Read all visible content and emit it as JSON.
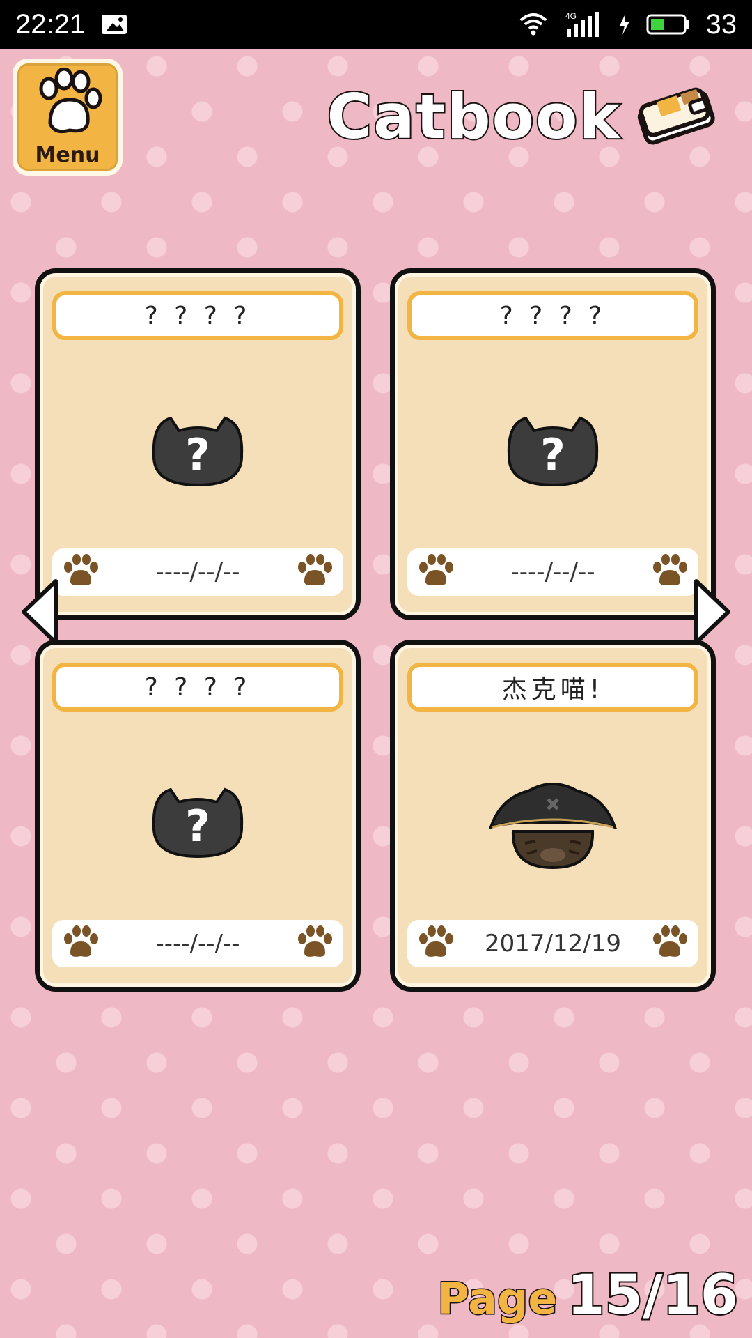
{
  "status_bar": {
    "time": "22:21",
    "network": "4G",
    "battery": "33",
    "icons": [
      "image-icon",
      "wifi-icon",
      "signal-icon",
      "charging-icon",
      "battery-icon"
    ]
  },
  "header": {
    "menu_label": "Menu",
    "title": "Catbook"
  },
  "cards": [
    {
      "name": "? ? ? ?",
      "date": "----/--/--",
      "discovered": false
    },
    {
      "name": "? ? ? ?",
      "date": "----/--/--",
      "discovered": false
    },
    {
      "name": "? ? ? ?",
      "date": "----/--/--",
      "discovered": false
    },
    {
      "name": "杰克喵!",
      "date": "2017/12/19",
      "discovered": true
    }
  ],
  "pagination": {
    "label": "Page",
    "value": "15/16"
  },
  "colors": {
    "background": "#efb8c5",
    "card": "#f4dfb8",
    "accent": "#f2b543",
    "paw": "#7a5426"
  }
}
